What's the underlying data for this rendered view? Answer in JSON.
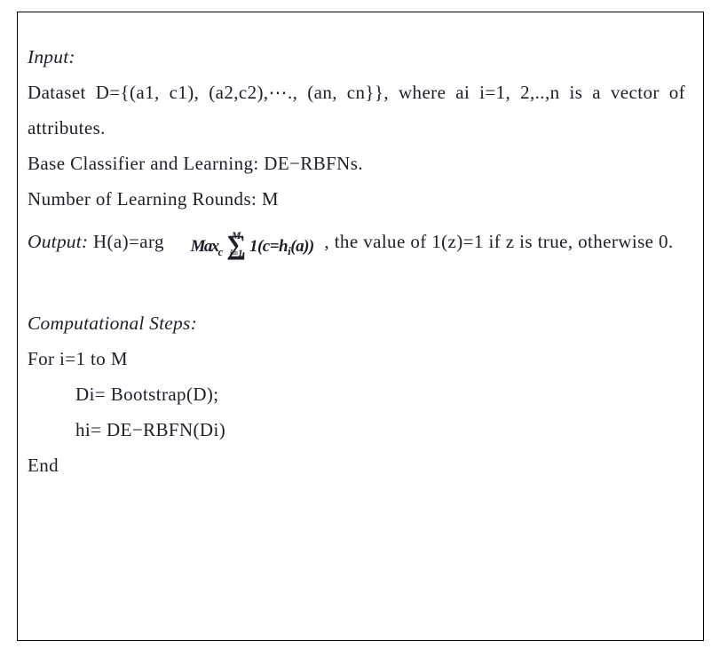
{
  "document": {
    "type": "algorithm-pseudocode-box",
    "border_color": "#000000",
    "text_color": "#1e1e28",
    "background_color": "#ffffff"
  },
  "algorithm": {
    "input_label": "Input:",
    "input_lines": [
      "Dataset D={(a1, c1), (a2,c2),⋯., (an, cn}}, where ai i=1, 2,..,n is a vector of attributes.",
      "Base Classifier and Learning: DE−RBFNs.",
      "Number of Learning Rounds: M"
    ],
    "output_label": "Output:",
    "output_prefix": "H(a)=arg",
    "output_suffix": ", the value of 1(z)=1 if z is true, otherwise 0.",
    "formula": {
      "operator": "Max",
      "operator_subscript": "c",
      "sum_symbol": "∑",
      "sum_upper": "M",
      "sum_lower": "i=1",
      "indicator": "1(c",
      "equals": "=",
      "hypothesis": "h",
      "hypothesis_subscript": "i",
      "argument": "(a))",
      "plain_text": "Max_c ∑_{i=1}^{M} 1(c=h_i(a))"
    },
    "steps_label": "Computational Steps:",
    "steps": [
      {
        "text": "For i=1 to M",
        "indent": 0
      },
      {
        "text": "Di= Bootstrap(D);",
        "indent": 1
      },
      {
        "text": "hi= DE−RBFN(Di)",
        "indent": 1
      },
      {
        "text": "End",
        "indent": 0
      }
    ]
  }
}
